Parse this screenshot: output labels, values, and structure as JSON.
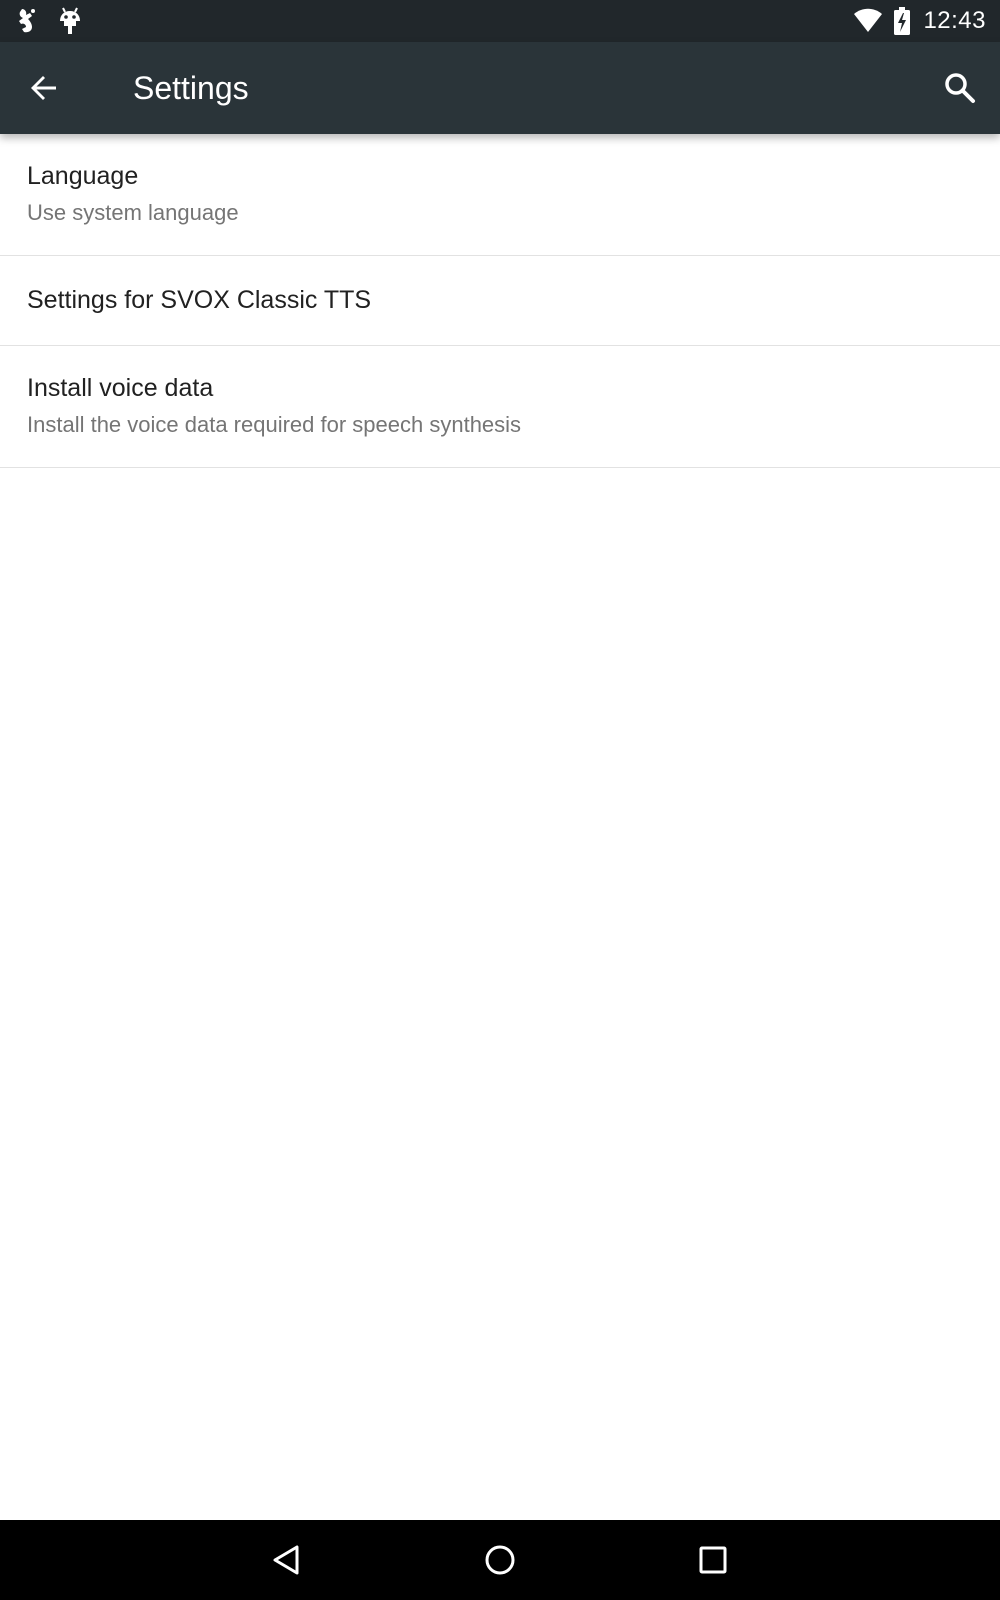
{
  "status_bar": {
    "time": "12:43",
    "icons_left": [
      "notification-icon",
      "android-icon"
    ],
    "icons_right": [
      "wifi-icon",
      "battery-charging-icon"
    ]
  },
  "toolbar": {
    "title": "Settings",
    "back_icon": "arrow-back-icon",
    "search_icon": "search-icon"
  },
  "preferences": [
    {
      "title": "Language",
      "summary": "Use system language"
    },
    {
      "title": "Settings for SVOX Classic TTS"
    },
    {
      "title": "Install voice data",
      "summary": "Install the voice data required for speech synthesis"
    }
  ],
  "nav_bar": {
    "buttons": [
      "back-nav-icon",
      "home-nav-icon",
      "recents-nav-icon"
    ]
  },
  "colors": {
    "status_bar": "#21272b",
    "toolbar": "#2a3439",
    "background": "#ffffff",
    "title_text": "#212121",
    "summary_text": "#757575",
    "divider": "#e2e2e2",
    "nav_bar": "#000000"
  }
}
